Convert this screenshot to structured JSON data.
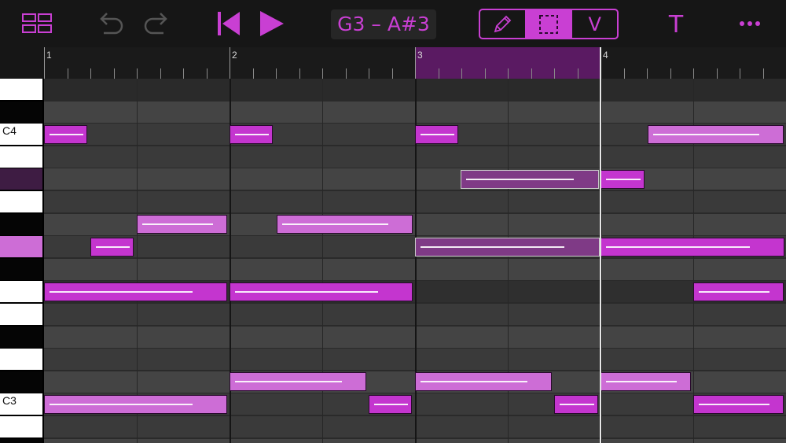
{
  "toolbar": {
    "grid_view_icon": "grid-view-icon",
    "undo_icon": "undo-icon",
    "redo_icon": "redo-icon",
    "skip_back_icon": "skip-to-start-icon",
    "play_icon": "play-icon",
    "range_label": "G3 – A#3",
    "tools": [
      {
        "name": "pencil",
        "icon": "pencil-icon",
        "active": false
      },
      {
        "name": "select",
        "icon": "marquee-select-icon",
        "active": true
      },
      {
        "name": "velocity",
        "label": "V",
        "active": false
      }
    ],
    "text_tool_label": "T",
    "more_icon": "more-icon"
  },
  "ruler": {
    "bars": [
      "1",
      "2",
      "3",
      "4"
    ],
    "loop_region_bar": "3"
  },
  "keyboard": {
    "labels": {
      "c4": "C4",
      "c3": "C3"
    }
  },
  "colors": {
    "accent": "#c93fd3",
    "note_bright": "#c435cf",
    "note_light": "#cd6dd6",
    "note_selected": "#7f3a86",
    "loop_highlight": "#5a1a62"
  }
}
